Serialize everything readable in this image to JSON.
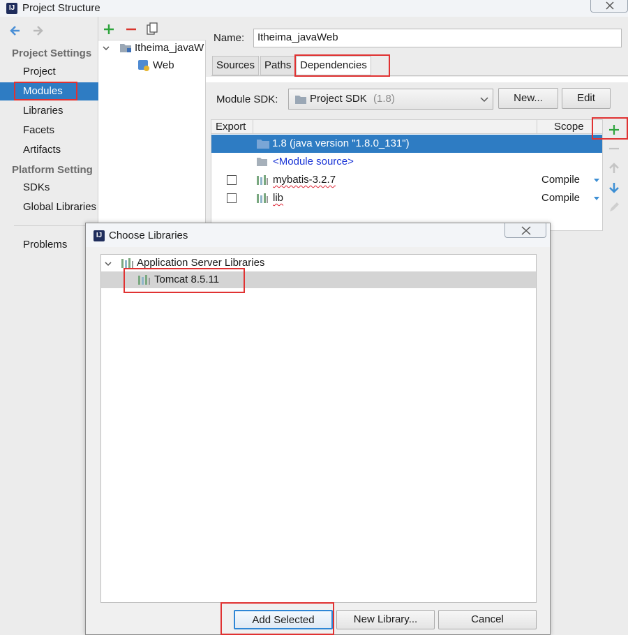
{
  "window": {
    "title": "Project Structure"
  },
  "nav": {
    "back_icon": "arrow-left-icon",
    "forward_icon": "arrow-right-icon",
    "project_settings_header": "Project Settings",
    "project_settings_items": [
      "Project",
      "Modules",
      "Libraries",
      "Facets",
      "Artifacts"
    ],
    "platform_settings_header": "Platform Setting",
    "platform_settings_items": [
      "SDKs",
      "Global Libraries"
    ],
    "problems": "Problems",
    "selected": "Modules"
  },
  "tree": {
    "module_name": "Itheima_javaW",
    "facet_name": "Web"
  },
  "main": {
    "name_label": "Name:",
    "name_value": "Itheima_javaWeb",
    "tabs": [
      "Sources",
      "Paths",
      "Dependencies"
    ],
    "active_tab": "Dependencies",
    "sdk_label": "Module SDK:",
    "sdk_value": "Project SDK",
    "sdk_version": "(1.8)",
    "new_button": "New...",
    "edit_button": "Edit",
    "table": {
      "headers": {
        "export": "Export",
        "scope": "Scope"
      },
      "rows": [
        {
          "name": "1.8 (java version \"1.8.0_131\")",
          "scope": "",
          "selected": true
        },
        {
          "name": "<Module source>",
          "scope": ""
        },
        {
          "name": "mybatis-3.2.7",
          "scope": "Compile"
        },
        {
          "name": "lib",
          "scope": "Compile"
        }
      ]
    }
  },
  "dialog": {
    "title": "Choose Libraries",
    "group": "Application Server Libraries",
    "item": "Tomcat 8.5.11",
    "add_selected": "Add Selected",
    "new_library": "New Library...",
    "cancel": "Cancel"
  },
  "colors": {
    "selection": "#2e7cc3",
    "highlight_box": "#e03232",
    "add_green": "#2ea43c",
    "remove_red": "#d9352d",
    "link_blue": "#1a35d6"
  }
}
